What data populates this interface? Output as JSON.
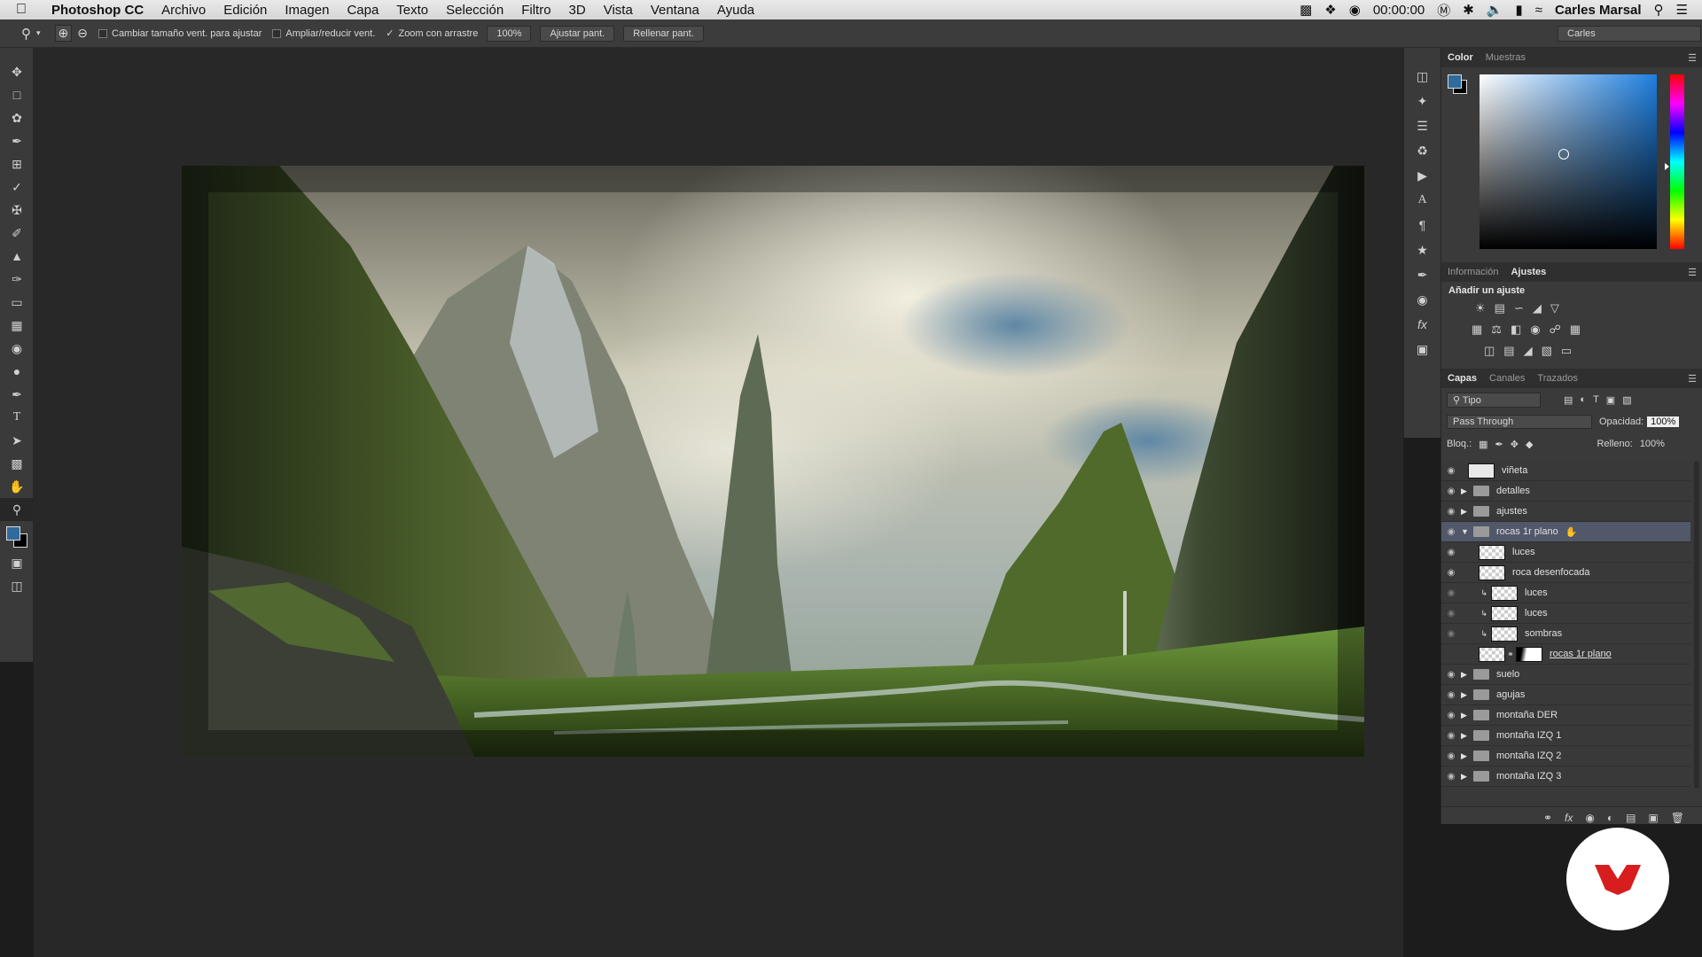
{
  "menubar": {
    "app_name": "Photoshop CC",
    "items": [
      "Archivo",
      "Edición",
      "Imagen",
      "Capa",
      "Texto",
      "Selección",
      "Filtro",
      "3D",
      "Vista",
      "Ventana",
      "Ayuda"
    ],
    "clock": "00:00:00",
    "user": "Carles Marsal"
  },
  "options": {
    "cb_resize": "Cambiar tamaño vent. para ajustar",
    "cb_zoom_all": "Ampliar/reducir vent.",
    "cb_scrubby": "Zoom con arrastre",
    "zoom_value": "100%",
    "fit_btn": "Ajustar pant.",
    "fill_btn": "Rellenar pant.",
    "workspace": "Carles"
  },
  "color_panel": {
    "tabs": [
      "Color",
      "Muestras"
    ],
    "foreground": "#2f6b9c",
    "background": "#000000"
  },
  "adjust_panel": {
    "tabs": [
      "Información",
      "Ajustes"
    ],
    "title": "Añadir un ajuste"
  },
  "layers_panel": {
    "tabs": [
      "Capas",
      "Canales",
      "Trazados"
    ],
    "filter": "Tipo",
    "blend_mode": "Pass Through",
    "opacity_label": "Opacidad:",
    "opacity": "100%",
    "lock_label": "Bloq.:",
    "fill_label": "Relleno:",
    "fill": "100%",
    "layers": [
      {
        "name": "viñeta",
        "kind": "layer",
        "indent": 0,
        "visible": true
      },
      {
        "name": "detalles",
        "kind": "group",
        "indent": 0,
        "visible": true
      },
      {
        "name": "ajustes",
        "kind": "group",
        "indent": 0,
        "visible": true
      },
      {
        "name": "rocas 1r plano",
        "kind": "group-open",
        "indent": 0,
        "visible": true,
        "selected": true
      },
      {
        "name": "luces",
        "kind": "layer",
        "indent": 1,
        "visible": true
      },
      {
        "name": "roca desenfocada",
        "kind": "layer",
        "indent": 1,
        "visible": true
      },
      {
        "name": "luces",
        "kind": "clip",
        "indent": 2,
        "visible": true
      },
      {
        "name": "luces",
        "kind": "clip",
        "indent": 2,
        "visible": true
      },
      {
        "name": "sombras",
        "kind": "clip",
        "indent": 2,
        "visible": true
      },
      {
        "name": "rocas 1r plano",
        "kind": "masked",
        "indent": 1,
        "visible": false
      },
      {
        "name": "suelo",
        "kind": "group",
        "indent": 0,
        "visible": true
      },
      {
        "name": "agujas",
        "kind": "group",
        "indent": 0,
        "visible": true
      },
      {
        "name": "montaña DER",
        "kind": "group",
        "indent": 0,
        "visible": true
      },
      {
        "name": "montaña IZQ 1",
        "kind": "group",
        "indent": 0,
        "visible": true
      },
      {
        "name": "montaña IZQ 2",
        "kind": "group",
        "indent": 0,
        "visible": true
      },
      {
        "name": "montaña IZQ 3",
        "kind": "group",
        "indent": 0,
        "visible": true
      }
    ]
  }
}
